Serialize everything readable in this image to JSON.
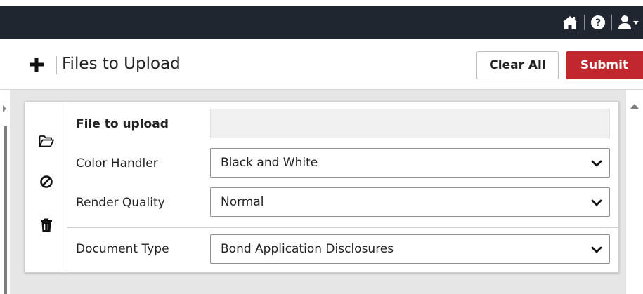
{
  "topbar": {
    "icons": [
      "home-icon",
      "help-icon",
      "user-menu-icon"
    ]
  },
  "header": {
    "title": "Files to Upload",
    "add_icon": "plus-icon",
    "clear_label": "Clear All",
    "submit_label": "Submit"
  },
  "colors": {
    "topbar_bg": "#1f2630",
    "submit_bg": "#c0282d",
    "panel_bg": "#e6e6e6"
  },
  "card": {
    "side_icons": [
      "folder-open-icon",
      "cancel-icon",
      "trash-icon"
    ],
    "fields": {
      "file": {
        "label": "File to upload",
        "value": ""
      },
      "color": {
        "label": "Color Handler",
        "value": "Black and White"
      },
      "quality": {
        "label": "Render Quality",
        "value": "Normal"
      },
      "doctype": {
        "label": "Document Type",
        "value": "Bond Application Disclosures"
      }
    }
  }
}
